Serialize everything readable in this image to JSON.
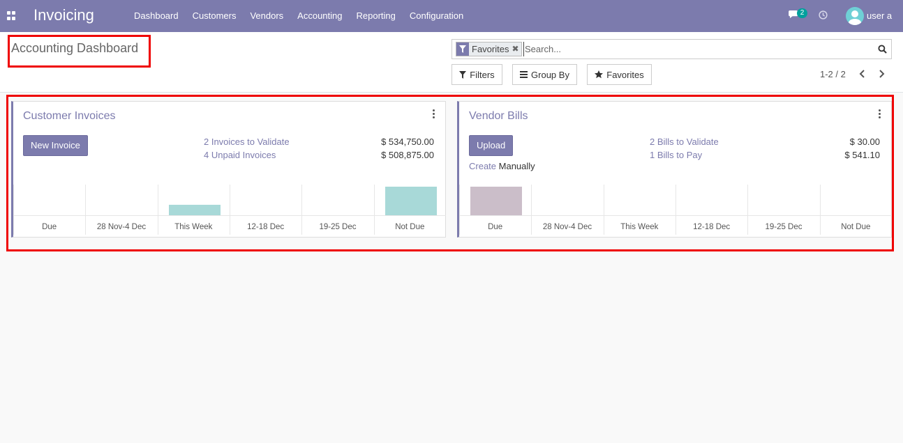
{
  "navbar": {
    "brand": "Invoicing",
    "menu": [
      "Dashboard",
      "Customers",
      "Vendors",
      "Accounting",
      "Reporting",
      "Configuration"
    ],
    "chat_count": "2",
    "user": "user a",
    "color": "#7c7bad"
  },
  "control_panel": {
    "breadcrumb": "Accounting Dashboard",
    "search": {
      "facet": "Favorites",
      "placeholder": "Search..."
    },
    "buttons": {
      "filters": "Filters",
      "group_by": "Group By",
      "favorites": "Favorites"
    },
    "pager": "1-2 / 2"
  },
  "dashboard": {
    "customer_invoices": {
      "title": "Customer Invoices",
      "button": "New Invoice",
      "lines": [
        {
          "label": "2 Invoices to Validate",
          "amount": "$ 534,750.00"
        },
        {
          "label": "4 Unpaid Invoices",
          "amount": "$ 508,875.00"
        }
      ],
      "chart": {
        "type": "bar",
        "bar_color": "#a8d9d8",
        "categories": [
          "Due",
          "28 Nov-4 Dec",
          "This Week",
          "12-18 Dec",
          "19-25 Dec",
          "Not Due"
        ],
        "values": [
          0,
          0,
          0.36,
          0,
          0,
          1.0
        ]
      }
    },
    "vendor_bills": {
      "title": "Vendor Bills",
      "button": "Upload",
      "create_link": "Create",
      "create_text": " Manually",
      "lines": [
        {
          "label": "2 Bills to Validate",
          "amount": "$ 30.00"
        },
        {
          "label": "1 Bills to Pay",
          "amount": "$ 541.10"
        }
      ],
      "chart": {
        "type": "bar",
        "bar_color": "#cbbec9",
        "categories": [
          "Due",
          "28 Nov-4 Dec",
          "This Week",
          "12-18 Dec",
          "19-25 Dec",
          "Not Due"
        ],
        "values": [
          1.0,
          0,
          0,
          0,
          0,
          0
        ]
      }
    }
  }
}
